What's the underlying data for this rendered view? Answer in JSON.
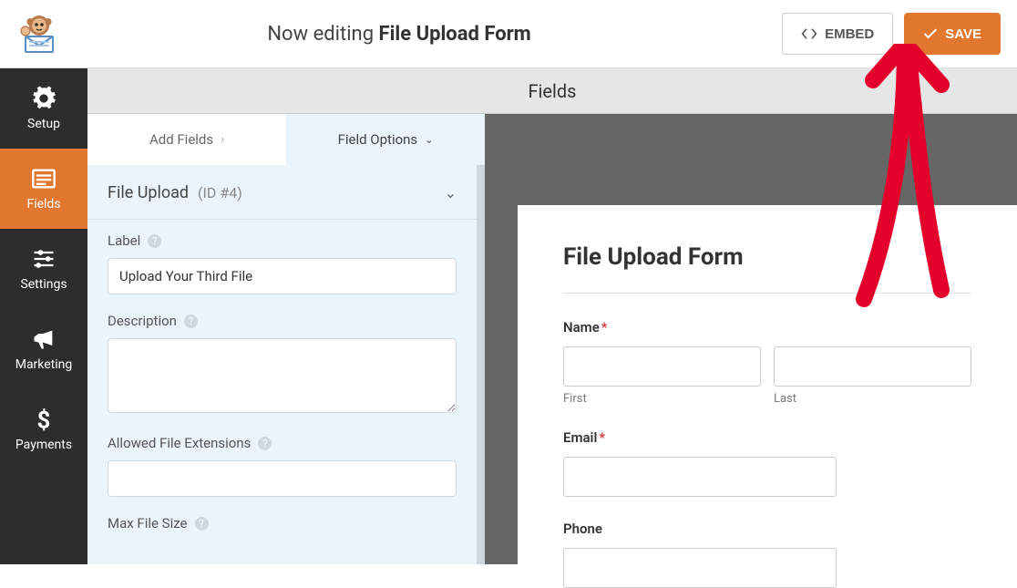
{
  "header": {
    "now_editing": "Now editing",
    "form_name": "File Upload Form",
    "embed_label": "EMBED",
    "save_label": "SAVE"
  },
  "sidebar": {
    "items": [
      {
        "label": "Setup"
      },
      {
        "label": "Fields"
      },
      {
        "label": "Settings"
      },
      {
        "label": "Marketing"
      },
      {
        "label": "Payments"
      }
    ]
  },
  "panel": {
    "header": "Fields",
    "tabs": {
      "add": "Add Fields",
      "options": "Field Options"
    },
    "section": {
      "name": "File Upload",
      "id_text": "(ID #4)"
    },
    "fields": {
      "label_label": "Label",
      "label_value": "Upload Your Third File",
      "description_label": "Description",
      "description_value": "",
      "extensions_label": "Allowed File Extensions",
      "extensions_value": "",
      "maxsize_label": "Max File Size"
    }
  },
  "preview": {
    "title": "File Upload Form",
    "name_label": "Name",
    "first_label": "First",
    "last_label": "Last",
    "email_label": "Email",
    "phone_label": "Phone"
  }
}
